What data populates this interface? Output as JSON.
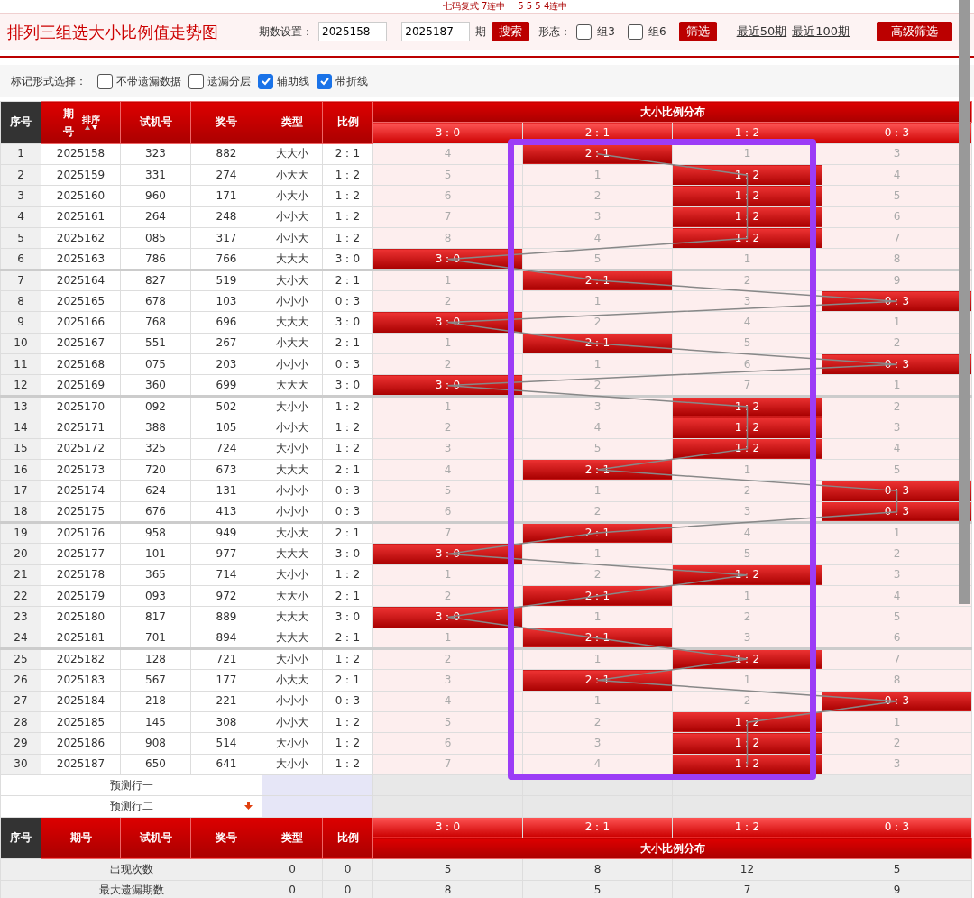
{
  "top_strip": [
    "七码复式 7连中",
    "5 5 5 4连中"
  ],
  "title": "排列三组选大小比例值走势图",
  "filter": {
    "period_label": "期数设置：",
    "from": "2025158",
    "dash": "-",
    "to": "2025187",
    "unit": "期",
    "search_button": "搜索",
    "shape_label": "形态：",
    "shapes": [
      {
        "label": "组3",
        "checked": false
      },
      {
        "label": "组6",
        "checked": false
      }
    ],
    "filter_button": "筛选",
    "links": [
      "最近50期",
      "最近100期"
    ],
    "advanced_button": "高级筛选"
  },
  "marks": {
    "label": "标记形式选择：",
    "options": [
      {
        "label": "不带遗漏数据",
        "checked": false
      },
      {
        "label": "遗漏分层",
        "checked": false
      },
      {
        "label": "辅助线",
        "checked": true
      },
      {
        "label": "带折线",
        "checked": true
      }
    ]
  },
  "table": {
    "columns": [
      "序号",
      "期号",
      "试机号",
      "奖号",
      "类型",
      "比例"
    ],
    "sort_label": "排序",
    "group_title": "大小比例分布",
    "dist_columns": [
      "3：0",
      "2：1",
      "1：2",
      "0：3"
    ],
    "rows": [
      {
        "no": "1",
        "period": "2025158",
        "trial": "323",
        "draw": "882",
        "type": "大大小",
        "ratio": "2：1",
        "dist": [
          "4",
          "2：1",
          "1",
          "3"
        ],
        "hits": [
          false,
          true,
          false,
          false
        ]
      },
      {
        "no": "2",
        "period": "2025159",
        "trial": "331",
        "draw": "274",
        "type": "小大大",
        "ratio": "1：2",
        "dist": [
          "5",
          "1",
          "1：2",
          "4"
        ],
        "hits": [
          false,
          false,
          true,
          false
        ]
      },
      {
        "no": "3",
        "period": "2025160",
        "trial": "960",
        "draw": "171",
        "type": "小大小",
        "ratio": "1：2",
        "dist": [
          "6",
          "2",
          "1：2",
          "5"
        ],
        "hits": [
          false,
          false,
          true,
          false
        ]
      },
      {
        "no": "4",
        "period": "2025161",
        "trial": "264",
        "draw": "248",
        "type": "小小大",
        "ratio": "1：2",
        "dist": [
          "7",
          "3",
          "1：2",
          "6"
        ],
        "hits": [
          false,
          false,
          true,
          false
        ]
      },
      {
        "no": "5",
        "period": "2025162",
        "trial": "085",
        "draw": "317",
        "type": "小小大",
        "ratio": "1：2",
        "dist": [
          "8",
          "4",
          "1：2",
          "7"
        ],
        "hits": [
          false,
          false,
          true,
          false
        ]
      },
      {
        "no": "6",
        "period": "2025163",
        "trial": "786",
        "draw": "766",
        "type": "大大大",
        "ratio": "3：0",
        "dist": [
          "3：0",
          "5",
          "1",
          "8"
        ],
        "hits": [
          true,
          false,
          false,
          false
        ]
      },
      {
        "no": "7",
        "period": "2025164",
        "trial": "827",
        "draw": "519",
        "type": "大小大",
        "ratio": "2：1",
        "dist": [
          "1",
          "2：1",
          "2",
          "9"
        ],
        "hits": [
          false,
          true,
          false,
          false
        ]
      },
      {
        "no": "8",
        "period": "2025165",
        "trial": "678",
        "draw": "103",
        "type": "小小小",
        "ratio": "0：3",
        "dist": [
          "2",
          "1",
          "3",
          "0：3"
        ],
        "hits": [
          false,
          false,
          false,
          true
        ]
      },
      {
        "no": "9",
        "period": "2025166",
        "trial": "768",
        "draw": "696",
        "type": "大大大",
        "ratio": "3：0",
        "dist": [
          "3：0",
          "2",
          "4",
          "1"
        ],
        "hits": [
          true,
          false,
          false,
          false
        ]
      },
      {
        "no": "10",
        "period": "2025167",
        "trial": "551",
        "draw": "267",
        "type": "小大大",
        "ratio": "2：1",
        "dist": [
          "1",
          "2：1",
          "5",
          "2"
        ],
        "hits": [
          false,
          true,
          false,
          false
        ]
      },
      {
        "no": "11",
        "period": "2025168",
        "trial": "075",
        "draw": "203",
        "type": "小小小",
        "ratio": "0：3",
        "dist": [
          "2",
          "1",
          "6",
          "0：3"
        ],
        "hits": [
          false,
          false,
          false,
          true
        ]
      },
      {
        "no": "12",
        "period": "2025169",
        "trial": "360",
        "draw": "699",
        "type": "大大大",
        "ratio": "3：0",
        "dist": [
          "3：0",
          "2",
          "7",
          "1"
        ],
        "hits": [
          true,
          false,
          false,
          false
        ]
      },
      {
        "no": "13",
        "period": "2025170",
        "trial": "092",
        "draw": "502",
        "type": "大小小",
        "ratio": "1：2",
        "dist": [
          "1",
          "3",
          "1：2",
          "2"
        ],
        "hits": [
          false,
          false,
          true,
          false
        ]
      },
      {
        "no": "14",
        "period": "2025171",
        "trial": "388",
        "draw": "105",
        "type": "小小大",
        "ratio": "1：2",
        "dist": [
          "2",
          "4",
          "1：2",
          "3"
        ],
        "hits": [
          false,
          false,
          true,
          false
        ]
      },
      {
        "no": "15",
        "period": "2025172",
        "trial": "325",
        "draw": "724",
        "type": "大小小",
        "ratio": "1：2",
        "dist": [
          "3",
          "5",
          "1：2",
          "4"
        ],
        "hits": [
          false,
          false,
          true,
          false
        ]
      },
      {
        "no": "16",
        "period": "2025173",
        "trial": "720",
        "draw": "673",
        "type": "大大大",
        "ratio": "2：1",
        "dist": [
          "4",
          "2：1",
          "1",
          "5"
        ],
        "hits": [
          false,
          true,
          false,
          false
        ]
      },
      {
        "no": "17",
        "period": "2025174",
        "trial": "624",
        "draw": "131",
        "type": "小小小",
        "ratio": "0：3",
        "dist": [
          "5",
          "1",
          "2",
          "0：3"
        ],
        "hits": [
          false,
          false,
          false,
          true
        ]
      },
      {
        "no": "18",
        "period": "2025175",
        "trial": "676",
        "draw": "413",
        "type": "小小小",
        "ratio": "0：3",
        "dist": [
          "6",
          "2",
          "3",
          "0：3"
        ],
        "hits": [
          false,
          false,
          false,
          true
        ]
      },
      {
        "no": "19",
        "period": "2025176",
        "trial": "958",
        "draw": "949",
        "type": "大小大",
        "ratio": "2：1",
        "dist": [
          "7",
          "2：1",
          "4",
          "1"
        ],
        "hits": [
          false,
          true,
          false,
          false
        ]
      },
      {
        "no": "20",
        "period": "2025177",
        "trial": "101",
        "draw": "977",
        "type": "大大大",
        "ratio": "3：0",
        "dist": [
          "3：0",
          "1",
          "5",
          "2"
        ],
        "hits": [
          true,
          false,
          false,
          false
        ]
      },
      {
        "no": "21",
        "period": "2025178",
        "trial": "365",
        "draw": "714",
        "type": "大小小",
        "ratio": "1：2",
        "dist": [
          "1",
          "2",
          "1：2",
          "3"
        ],
        "hits": [
          false,
          false,
          true,
          false
        ]
      },
      {
        "no": "22",
        "period": "2025179",
        "trial": "093",
        "draw": "972",
        "type": "大大小",
        "ratio": "2：1",
        "dist": [
          "2",
          "2：1",
          "1",
          "4"
        ],
        "hits": [
          false,
          true,
          false,
          false
        ]
      },
      {
        "no": "23",
        "period": "2025180",
        "trial": "817",
        "draw": "889",
        "type": "大大大",
        "ratio": "3：0",
        "dist": [
          "3：0",
          "1",
          "2",
          "5"
        ],
        "hits": [
          true,
          false,
          false,
          false
        ]
      },
      {
        "no": "24",
        "period": "2025181",
        "trial": "701",
        "draw": "894",
        "type": "大大大",
        "ratio": "2：1",
        "dist": [
          "1",
          "2：1",
          "3",
          "6"
        ],
        "hits": [
          false,
          true,
          false,
          false
        ]
      },
      {
        "no": "25",
        "period": "2025182",
        "trial": "128",
        "draw": "721",
        "type": "大小小",
        "ratio": "1：2",
        "dist": [
          "2",
          "1",
          "1：2",
          "7"
        ],
        "hits": [
          false,
          false,
          true,
          false
        ]
      },
      {
        "no": "26",
        "period": "2025183",
        "trial": "567",
        "draw": "177",
        "type": "小大大",
        "ratio": "2：1",
        "dist": [
          "3",
          "2：1",
          "1",
          "8"
        ],
        "hits": [
          false,
          true,
          false,
          false
        ]
      },
      {
        "no": "27",
        "period": "2025184",
        "trial": "218",
        "draw": "221",
        "type": "小小小",
        "ratio": "0：3",
        "dist": [
          "4",
          "1",
          "2",
          "0：3"
        ],
        "hits": [
          false,
          false,
          false,
          true
        ]
      },
      {
        "no": "28",
        "period": "2025185",
        "trial": "145",
        "draw": "308",
        "type": "小小大",
        "ratio": "1：2",
        "dist": [
          "5",
          "2",
          "1：2",
          "1"
        ],
        "hits": [
          false,
          false,
          true,
          false
        ]
      },
      {
        "no": "29",
        "period": "2025186",
        "trial": "908",
        "draw": "514",
        "type": "大小小",
        "ratio": "1：2",
        "dist": [
          "6",
          "3",
          "1：2",
          "2"
        ],
        "hits": [
          false,
          false,
          true,
          false
        ]
      },
      {
        "no": "30",
        "period": "2025187",
        "trial": "650",
        "draw": "641",
        "type": "大小小",
        "ratio": "1：2",
        "dist": [
          "7",
          "4",
          "1：2",
          "3"
        ],
        "hits": [
          false,
          false,
          true,
          false
        ]
      }
    ],
    "predict_rows": [
      "预测行一",
      "预测行二"
    ],
    "footer_columns": [
      "序号",
      "期号",
      "试机号",
      "奖号",
      "类型",
      "比例"
    ],
    "footer_dist_columns": [
      "3：0",
      "2：1",
      "1：2",
      "0：3"
    ],
    "footer_group_title": "大小比例分布",
    "stats": [
      {
        "label": "出现次数",
        "values": [
          "0",
          "0",
          "5",
          "8",
          "12",
          "5"
        ]
      },
      {
        "label": "最大遗漏期数",
        "values": [
          "0",
          "0",
          "8",
          "5",
          "7",
          "9"
        ]
      }
    ]
  }
}
